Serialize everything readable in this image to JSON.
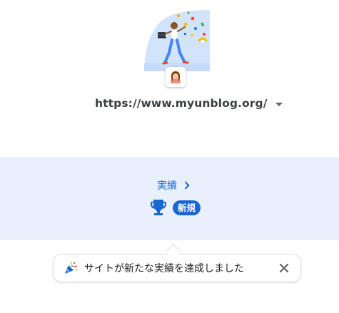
{
  "site": {
    "url": "https://www.myunblog.org/",
    "selector_icon": "caret-down-icon"
  },
  "achievements": {
    "link_label": "実績",
    "link_icon": "chevron-right-icon",
    "trophy_icon": "trophy-icon",
    "badge_label": "新規",
    "accent_color": "#1967d2",
    "band_color": "#e8f0fe"
  },
  "toast": {
    "icon": "party-popper-icon",
    "message": "サイトが新たな実績を達成しました",
    "close_icon": "close-icon"
  }
}
